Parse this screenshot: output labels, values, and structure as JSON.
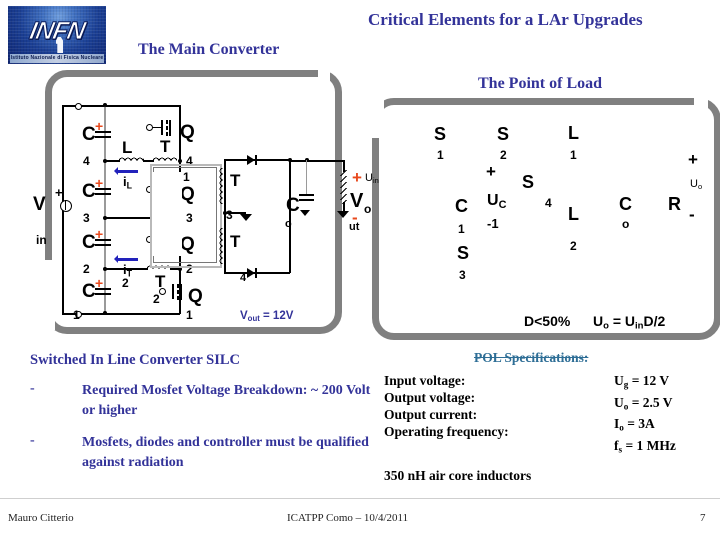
{
  "slide": {
    "main_title": "Critical Elements for a LAr Upgrades",
    "subtitle_left": "The Main Converter",
    "subtitle_right": "The Point of Load",
    "accent_blue": "#333399",
    "accent_teal": "#2e6e96",
    "accent_orange": "#e8491d",
    "frame_gray": "#808080"
  },
  "logo": {
    "name": "INFN",
    "caption": "Istituto Nazionale di Fisica Nucleare"
  },
  "main_converter": {
    "source_label": "V",
    "source_sub": "in",
    "source_plus": "+",
    "caps": [
      {
        "label": "C",
        "index": "4",
        "plus": "+"
      },
      {
        "label": "C",
        "index": "3",
        "plus": "+"
      },
      {
        "label": "C",
        "index": "2",
        "plus": "+"
      },
      {
        "label": "C",
        "index": "1",
        "plus": "+"
      }
    ],
    "inductor": {
      "label": "L",
      "current": "i",
      "current_sub": "L"
    },
    "transformer_primary": {
      "label": "T",
      "index": "1",
      "label2": "T",
      "index2": "2",
      "current": "i",
      "current_sub": "T"
    },
    "mosfets": [
      {
        "label": "Q",
        "index": "4"
      },
      {
        "label": "Q",
        "index": "3"
      },
      {
        "label": "Q",
        "index": "2"
      },
      {
        "label": "Q",
        "index": "1"
      }
    ],
    "rail_numbers": [
      "4",
      "3",
      "2",
      "1"
    ],
    "secondary": [
      {
        "label": "T",
        "index": "4"
      },
      {
        "label": "T",
        "index": "3"
      },
      {
        "label": "T",
        "index": "2"
      }
    ],
    "output_cap": {
      "label": "C",
      "index": "o"
    },
    "output": {
      "label": "V",
      "sub": "out",
      "plus": "+",
      "minus": "-"
    },
    "vout_note": "V",
    "vout_note_sub": "out",
    "vout_note_value": " = 12V"
  },
  "point_of_load": {
    "uin": "U",
    "uin_sub": "in",
    "switches": [
      {
        "label": "S",
        "index": "1"
      },
      {
        "label": "S",
        "index": "2"
      },
      {
        "label": "S",
        "index": "4"
      },
      {
        "label": "S",
        "index": "3"
      }
    ],
    "inductors": [
      {
        "label": "L",
        "index": "1"
      },
      {
        "label": "L",
        "index": "2"
      }
    ],
    "cap_flying": {
      "label": "C",
      "index": "1",
      "v_label": "U",
      "v_sub": "C",
      "plus": "+",
      "minus": "-"
    },
    "cap_out": {
      "label": "C",
      "index": "o"
    },
    "resistor": {
      "label": "R"
    },
    "uo": {
      "label": "U",
      "sub": "o",
      "plus": "+",
      "minus": "-"
    },
    "formula_duty": "D<50%",
    "formula_uo_a": "U",
    "formula_uo_a_sub": "o",
    "formula_uo_b": " = U",
    "formula_uo_b_sub": "in",
    "formula_uo_c": "D/2"
  },
  "silc": {
    "heading": "Switched In Line Converter SILC",
    "bullets": [
      {
        "dash": "-",
        "text": "Required Mosfet Voltage Breakdown: ~ 200 Volt or higher"
      },
      {
        "dash": "-",
        "text": "Mosfets, diodes and controller must be qualified against radiation"
      }
    ]
  },
  "pol_specs": {
    "heading": "POL Specifications:",
    "rows": [
      {
        "label": "Input voltage:",
        "sym": "U",
        "sub": "g",
        "value": " = 12 V"
      },
      {
        "label": "Output voltage:",
        "sym": "U",
        "sub": "o",
        "value": " = 2.5 V"
      },
      {
        "label": "Output current:",
        "sym": "I",
        "sub": "o",
        "value": " = 3A"
      },
      {
        "label": "Operating frequency:",
        "sym": "f",
        "sub": "s",
        "value": " = 1 MHz"
      }
    ],
    "note": "350 nH air core inductors"
  },
  "footer": {
    "author": "Mauro Citterio",
    "center": "ICATPP Como – 10/4/2011",
    "page": "7"
  }
}
